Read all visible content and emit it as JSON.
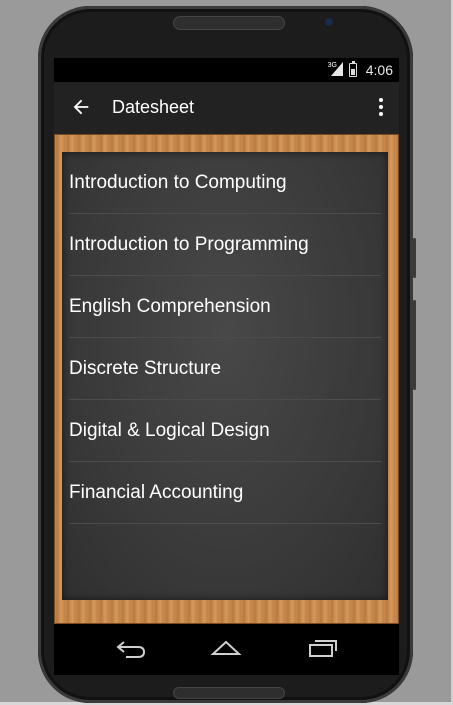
{
  "status_bar": {
    "network": "3G",
    "time": "4:06"
  },
  "app_bar": {
    "title": "Datesheet"
  },
  "courses": [
    "Introduction to Computing",
    "Introduction to Programming",
    "English Comprehension",
    "Discrete Structure",
    "Digital & Logical Design",
    "Financial Accounting"
  ],
  "icons": {
    "back": "arrow-back-icon",
    "menu": "more-vert-icon",
    "nav_back": "nav-back-icon",
    "nav_home": "nav-home-icon",
    "nav_recents": "nav-recents-icon"
  },
  "colors": {
    "app_bar": "#222222",
    "board": "#3b3b3b",
    "frame": "#c98b4e"
  }
}
